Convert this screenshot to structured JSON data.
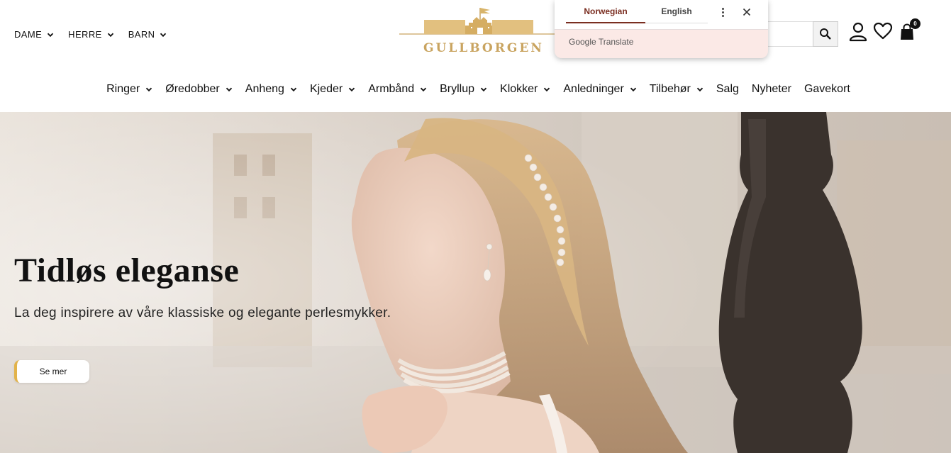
{
  "header": {
    "gender_nav": [
      {
        "label": "DAME"
      },
      {
        "label": "HERRE"
      },
      {
        "label": "BARN"
      }
    ],
    "logo_text": "GULLBORGEN",
    "cart_count": "0",
    "icons": [
      "search-icon",
      "user-icon",
      "heart-icon",
      "shopping-bag-icon"
    ]
  },
  "main_nav": [
    {
      "label": "Ringer",
      "dropdown": true
    },
    {
      "label": "Øredobber",
      "dropdown": true
    },
    {
      "label": "Anheng",
      "dropdown": true
    },
    {
      "label": "Kjeder",
      "dropdown": true
    },
    {
      "label": "Armbånd",
      "dropdown": true
    },
    {
      "label": "Bryllup",
      "dropdown": true
    },
    {
      "label": "Klokker",
      "dropdown": true
    },
    {
      "label": "Anledninger",
      "dropdown": true
    },
    {
      "label": "Tilbehør",
      "dropdown": true
    },
    {
      "label": "Salg",
      "dropdown": false
    },
    {
      "label": "Nyheter",
      "dropdown": false
    },
    {
      "label": "Gavekort",
      "dropdown": false
    }
  ],
  "translate_popup": {
    "tab_active": "Norwegian",
    "tab_inactive": "English",
    "brand_google": "Google",
    "brand_translate": "Translate"
  },
  "hero": {
    "title": "Tidløs eleganse",
    "subtitle": "La deg inspirere av våre klassiske og elegante perlesmykker.",
    "button_label": "Se mer"
  },
  "colors": {
    "accent_gold": "#c9a460",
    "button_border": "#e2b34a",
    "translate_active": "#7a2e21",
    "translate_bg": "#fbe9e6"
  }
}
